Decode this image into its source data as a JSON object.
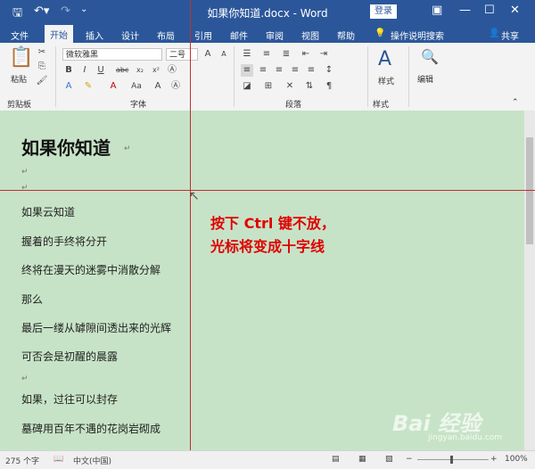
{
  "titlebar": {
    "title": "如果你知道.docx - Word",
    "login": "登录",
    "save_icon": "save-icon",
    "undo_icon": "undo-icon",
    "redo_icon": "redo-icon",
    "customize_icon": "customize-quickaccess-icon"
  },
  "tabs": [
    "文件",
    "开始",
    "插入",
    "设计",
    "布局",
    "引用",
    "邮件",
    "审阅",
    "视图",
    "帮助"
  ],
  "tell_me": "操作说明搜索",
  "share": "共享",
  "ribbon": {
    "paste": "粘贴",
    "clipboard": "剪贴板",
    "font_name": "微软雅黑",
    "font_size": "二号",
    "font_group": "字体",
    "paragraph_group": "段落",
    "styles": "样式",
    "styles_group": "样式",
    "edit": "编辑"
  },
  "document": {
    "heading": "如果你知道",
    "lines": [
      "如果云知道",
      "握着的手终将分开",
      "终将在漫天的迷雾中消散分解",
      "那么",
      "最后一缕从罅隙间透出来的光辉",
      "可否会是初醒的晨露",
      "",
      "如果，过往可以封存",
      "墓碑用百年不遇的花岗岩砌成"
    ]
  },
  "annotation": {
    "line1": "按下 Ctrl 键不放，",
    "line2": "光标将变成十字线"
  },
  "statusbar": {
    "word_count": "275 个字",
    "language": "中文(中国)",
    "zoom": "100%"
  },
  "watermark": {
    "text": "Bai 经验",
    "url": "jingyan.baidu.com"
  }
}
